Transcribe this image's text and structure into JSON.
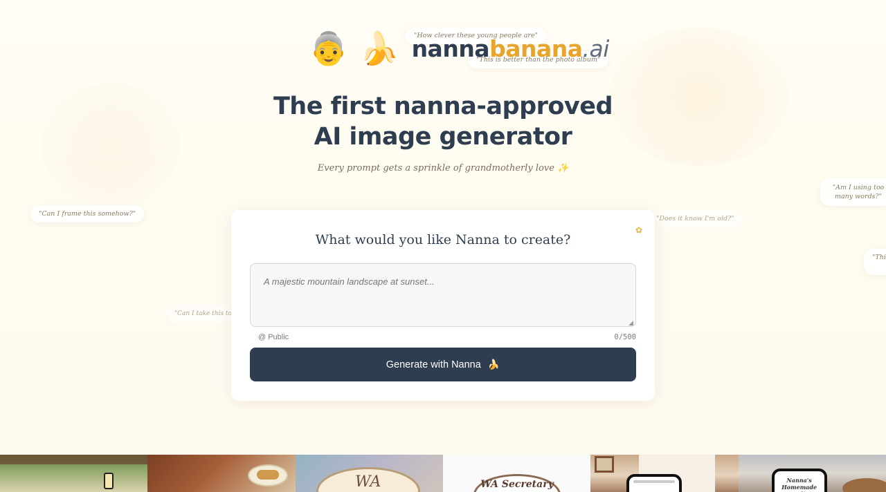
{
  "logo": {
    "emoji_nanna": "👵",
    "emoji_banana": "🍌",
    "wordmark_part1": "nanna",
    "wordmark_part2": "banana",
    "wordmark_part3": ".ai"
  },
  "quotes": [
    "\"How clever these young people are\"",
    "\"This is better than the photo album\"",
    "\"Can I frame this somehow?\"",
    "\"Does it know I'm old?\"",
    "\"Am I using too many words?\"",
    "\"This",
    "\"Can I take this to the"
  ],
  "hero": {
    "title_line1": "The first nanna-approved",
    "title_line2": "AI image generator",
    "subtitle": "Every prompt gets a sprinkle of grandmotherly love ✨"
  },
  "card": {
    "title": "What would you like Nanna to create?",
    "flower_icon": "✿",
    "prompt_placeholder": "A majestic mountain landscape at sunset...",
    "visibility_label": "@ Public",
    "char_count": "0/500",
    "generate_label": "Generate with Nanna",
    "generate_emoji": "🍌"
  },
  "gallery": {
    "tile3_text": "WA",
    "tile4_text": "WA Secretary",
    "tile6_text": "Nanna's Homemade Goodies"
  },
  "colors": {
    "primary": "#2e3e50",
    "accent": "#e7a52d",
    "background": "#fffbf0"
  }
}
